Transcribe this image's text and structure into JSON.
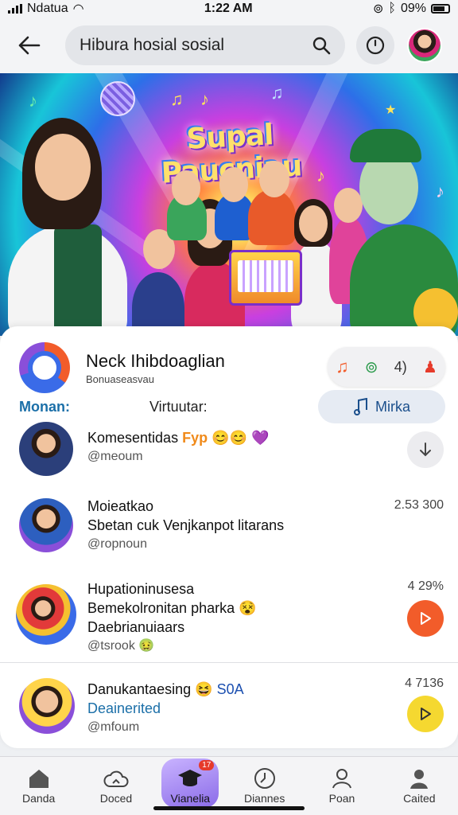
{
  "status": {
    "carrier": "Ndatua",
    "time": "1:22 AM",
    "battery": "09%"
  },
  "topbar": {
    "search_text": "Hibura hosial sosial"
  },
  "hero": {
    "title": "Supal Paucniau"
  },
  "channel": {
    "name": "Neck Ihibdoaglian",
    "subtitle": "Bonuaseasvau",
    "pill": {
      "glyph_a": "♫",
      "glyph_b": "⊚",
      "label": "4)",
      "glyph_c": "♟"
    }
  },
  "meta": {
    "left": "Monan:",
    "middle": "Virtuutar:",
    "button_label": "Mirka"
  },
  "items": [
    {
      "title": "Komesentidas",
      "title_tag": "Fyp",
      "emoji": "😊😊 💜",
      "handle": "@meoum"
    },
    {
      "title": "Moieatkao",
      "line2": "Sbetan cuk Venjkanpot litarans",
      "handle": "@ropnoun",
      "value": "2.53 300"
    },
    {
      "title": "Hupationinusesa",
      "line2": "Bemekolronitan pharka",
      "line3": "Daebrianuiaars",
      "emoji_line2": "😵",
      "handle": "@tsrook",
      "emoji_handle": "🤢",
      "value": "4 29%"
    },
    {
      "title": "Danukantaesing",
      "emoji": "😆",
      "title_tag": "S0A",
      "line2": "Deainerited",
      "handle": "@mfoum",
      "value": "4 7136"
    }
  ],
  "nav": [
    {
      "label": "Danda",
      "icon": "home-icon"
    },
    {
      "label": "Doced",
      "icon": "cloud-home-icon"
    },
    {
      "label": "Vianelia",
      "icon": "graduation-cap-icon",
      "badge": "17"
    },
    {
      "label": "Diannes",
      "icon": "clock-icon"
    },
    {
      "label": "Poan",
      "icon": "person-outline-icon"
    },
    {
      "label": "Caited",
      "icon": "person-icon"
    }
  ],
  "colors": {
    "accent_blue": "#1b6fa8",
    "orange": "#f25c2a",
    "yellow": "#f5d830",
    "nav_active": "#8a6be8"
  }
}
